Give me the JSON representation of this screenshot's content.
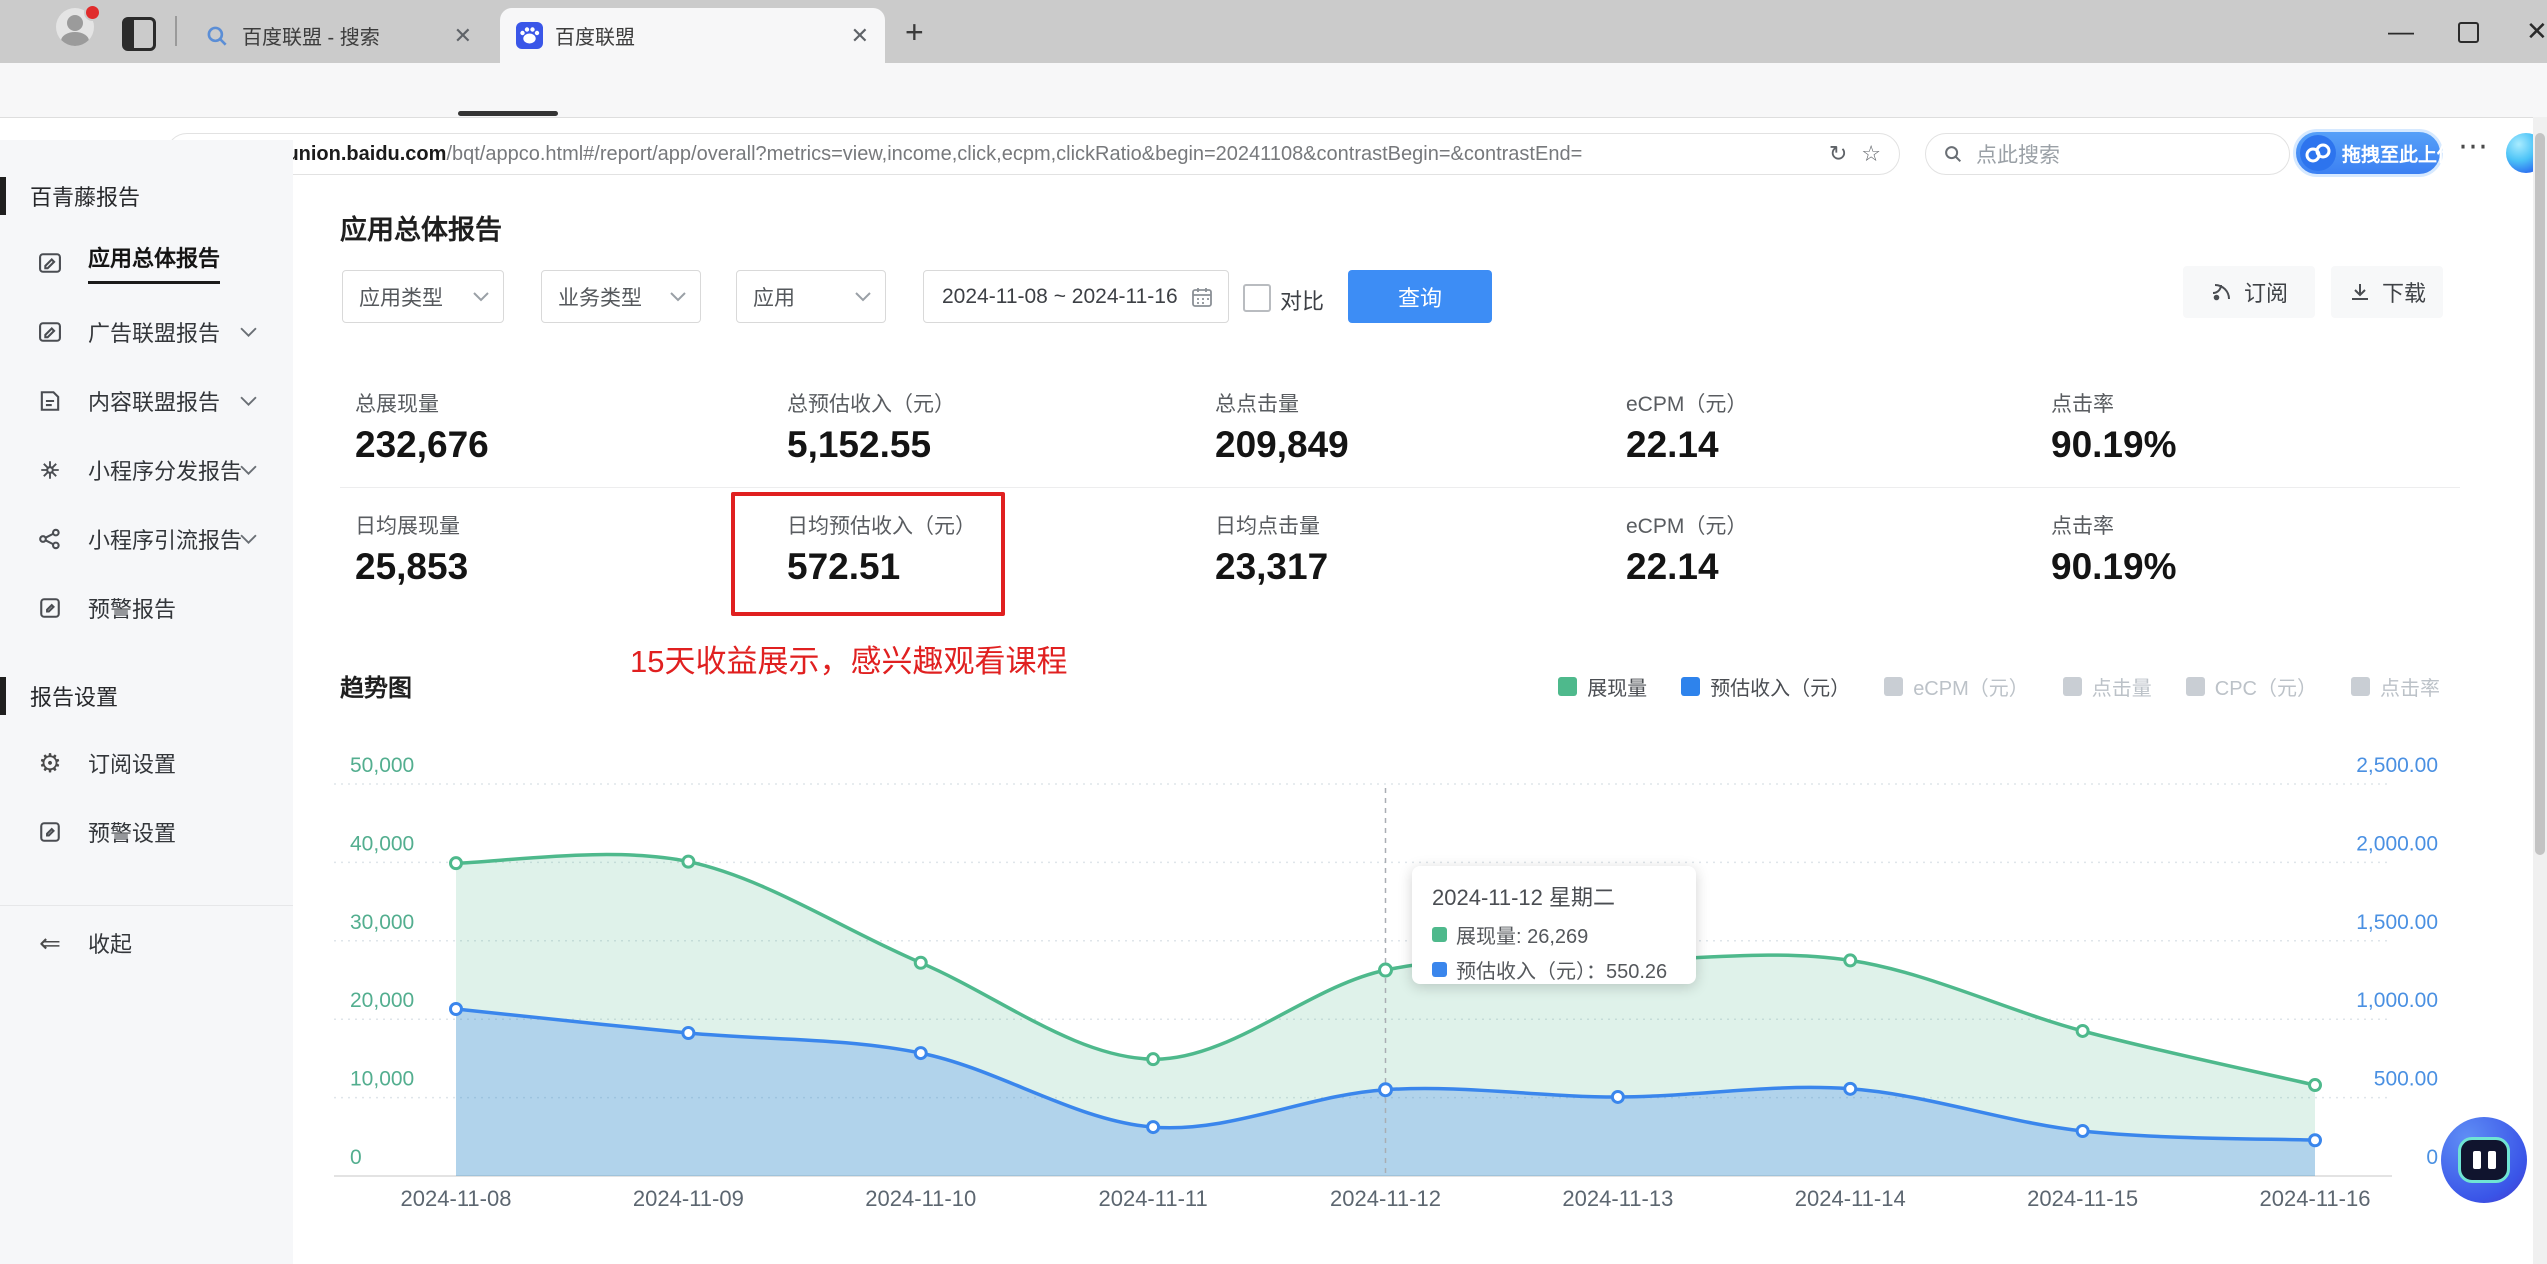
{
  "browser": {
    "tabs": [
      {
        "title": "百度联盟 - 搜索"
      },
      {
        "title": "百度联盟"
      }
    ],
    "url_scheme": "https://",
    "url_domain": "union.baidu.com",
    "url_path": "/bqt/appco.html#/report/app/overall?metrics=view,income,click,ecpm,clickRatio&begin=20241108&contrastBegin=&contrastEnd=",
    "search_placeholder": "点此搜索",
    "upload_badge_label": "拖拽至此上传"
  },
  "sidebar": {
    "section_reports": "百青藤报告",
    "items": [
      {
        "name": "sidebar-item-overall-report",
        "icon": "report-icon",
        "label": "应用总体报告",
        "active": true,
        "has_submenu": false
      },
      {
        "name": "sidebar-item-ad-union-report",
        "icon": "ad-report-icon",
        "label": "广告联盟报告",
        "active": false,
        "has_submenu": true
      },
      {
        "name": "sidebar-item-content-union-report",
        "icon": "content-report-icon",
        "label": "内容联盟报告",
        "active": false,
        "has_submenu": true
      },
      {
        "name": "sidebar-item-miniapp-dispatch-report",
        "icon": "miniapp-dispatch-icon",
        "label": "小程序分发报告",
        "active": false,
        "has_submenu": true
      },
      {
        "name": "sidebar-item-miniapp-referral-report",
        "icon": "miniapp-referral-icon",
        "label": "小程序引流报告",
        "active": false,
        "has_submenu": true
      },
      {
        "name": "sidebar-item-alert-report",
        "icon": "alert-report-icon",
        "label": "预警报告",
        "active": false,
        "has_submenu": false
      }
    ],
    "section_settings": "报告设置",
    "settings_items": [
      {
        "name": "sidebar-item-subscribe-settings",
        "icon": "gear-icon",
        "label": "订阅设置"
      },
      {
        "name": "sidebar-item-alert-settings",
        "icon": "alert-settings-icon",
        "label": "预警设置"
      }
    ],
    "collapse_label": "收起"
  },
  "page": {
    "title": "应用总体报告",
    "filters": {
      "app_type": "应用类型",
      "biz_type": "业务类型",
      "app": "应用",
      "date_range": "2024-11-08 ~ 2024-11-16",
      "compare_label": "对比",
      "query_label": "查询"
    },
    "actions": {
      "subscribe": "订阅",
      "download": "下载"
    },
    "stats_row1": [
      {
        "label": "总展现量",
        "value": "232,676"
      },
      {
        "label": "总预估收入（元）",
        "value": "5,152.55"
      },
      {
        "label": "总点击量",
        "value": "209,849"
      },
      {
        "label": "eCPM（元）",
        "value": "22.14"
      },
      {
        "label": "点击率",
        "value": "90.19%"
      }
    ],
    "stats_row2": [
      {
        "label": "日均展现量",
        "value": "25,853"
      },
      {
        "label": "日均预估收入（元）",
        "value": "572.51"
      },
      {
        "label": "日均点击量",
        "value": "23,317"
      },
      {
        "label": "eCPM（元）",
        "value": "22.14"
      },
      {
        "label": "点击率",
        "value": "90.19%"
      }
    ],
    "annotation": "15天收益展示，感兴趣观看课程",
    "trend_title": "趋势图"
  },
  "chart_data": {
    "type": "area",
    "title": "趋势图",
    "x": [
      "2024-11-08",
      "2024-11-09",
      "2024-11-10",
      "2024-11-11",
      "2024-11-12",
      "2024-11-13",
      "2024-11-14",
      "2024-11-15",
      "2024-11-16"
    ],
    "series": [
      {
        "name": "展现量",
        "axis": "left",
        "color": "#4eb98c",
        "fill": "rgba(78,185,140,0.18)",
        "values": [
          39900,
          40100,
          27200,
          14900,
          26269,
          27400,
          27500,
          18500,
          11600
        ]
      },
      {
        "name": "预估收入（元）",
        "axis": "right",
        "color": "#3a86ec",
        "fill": "rgba(58,134,236,0.28)",
        "values": [
          1065,
          912,
          784,
          312,
          550.26,
          504,
          556,
          287,
          228
        ]
      }
    ],
    "left_axis": {
      "min": 0,
      "max": 50000,
      "ticks": [
        "0",
        "10,000",
        "20,000",
        "30,000",
        "40,000",
        "50,000"
      ],
      "color": "#53ae8f"
    },
    "right_axis": {
      "min": 0,
      "max": 2500,
      "ticks": [
        "0",
        "500.00",
        "1,000.00",
        "1,500.00",
        "2,000.00",
        "2,500.00"
      ],
      "color": "#4a90e2"
    },
    "grid": true,
    "legend_position": "top-right",
    "hover_index": 4,
    "legend": [
      {
        "label": "展现量",
        "color": "#4eb98c",
        "active": true
      },
      {
        "label": "预估收入（元）",
        "color": "#2e83ec",
        "active": true
      },
      {
        "label": "eCPM（元）",
        "color": "#c9ced4",
        "active": false
      },
      {
        "label": "点击量",
        "color": "#c9ced4",
        "active": false
      },
      {
        "label": "CPC（元）",
        "color": "#c9ced4",
        "active": false
      },
      {
        "label": "点击率",
        "color": "#c9ced4",
        "active": false
      }
    ]
  },
  "tooltip": {
    "title": "2024-11-12 星期二",
    "rows": [
      {
        "label": "展现量",
        "value": "26,269",
        "sep": ": "
      },
      {
        "label": "预估收入（元）",
        "value": "550.26",
        "sep": "："
      }
    ]
  }
}
